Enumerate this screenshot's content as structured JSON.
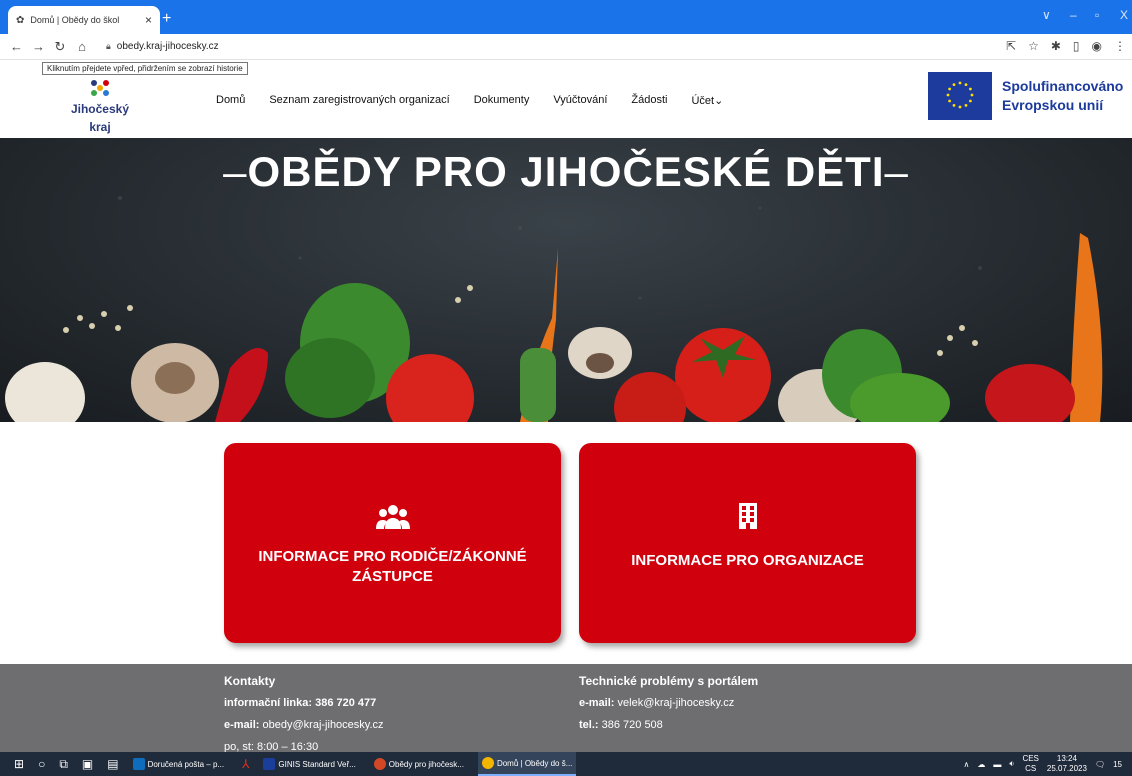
{
  "browser": {
    "tab_title": "Domů | Obědy do škol",
    "tab_close": "×",
    "new_tab": "+",
    "url": "obedy.kraj-jihocesky.cz",
    "tooltip": "Kliknutím přejdete vpřed, přidržením se zobrazí historie",
    "controls": {
      "min": "–",
      "max": "▫",
      "close": "X",
      "chev": "∨"
    }
  },
  "header": {
    "logo_text": "Jihočeský kraj",
    "nav": [
      "Domů",
      "Seznam zaregistrovaných organizací",
      "Dokumenty",
      "Vyúčtování",
      "Žádosti",
      "Účet⌄"
    ],
    "eu_line1": "Spolufinancováno",
    "eu_line2": "Evropskou unií"
  },
  "hero": {
    "title": "OBĚDY PRO JIHOČESKÉ DĚTI",
    "dash": "–"
  },
  "cards": [
    {
      "label_line1": "INFORMACE PRO RODIČE/ZÁKONNÉ",
      "label_line2": "ZÁSTUPCE",
      "icon": "users-icon"
    },
    {
      "label_line1": "INFORMACE PRO ORGANIZACE",
      "icon": "building-icon"
    }
  ],
  "footer": {
    "contacts_heading": "Kontakty",
    "info_line_label": "informační linka:",
    "info_line_value": "386 720 477",
    "email_label": "e-mail:",
    "email_value": "obedy@kraj-jihocesky.cz",
    "hours": "po, st: 8:00 – 16:30",
    "tech_heading": "Technické problémy s portálem",
    "tech_email_label": "e-mail:",
    "tech_email_value": "velek@kraj-jihocesky.cz",
    "tech_tel_label": "tel.:",
    "tech_tel_value": "386 720 508"
  },
  "taskbar": {
    "apps": [
      "Doručená pošta – p...",
      "GINIS Standard Veř...",
      "Obědy pro jihočesk...",
      "Domů | Obědy do š..."
    ],
    "lang_top": "CES",
    "lang_bottom": "CS",
    "time": "13:24",
    "date": "25.07.2023",
    "notif": "15"
  },
  "colors": {
    "brand_red": "#d0000d",
    "chrome_blue": "#1a73e8",
    "footer_gray": "#6e6e70",
    "eu_blue": "#1c3b9c"
  }
}
